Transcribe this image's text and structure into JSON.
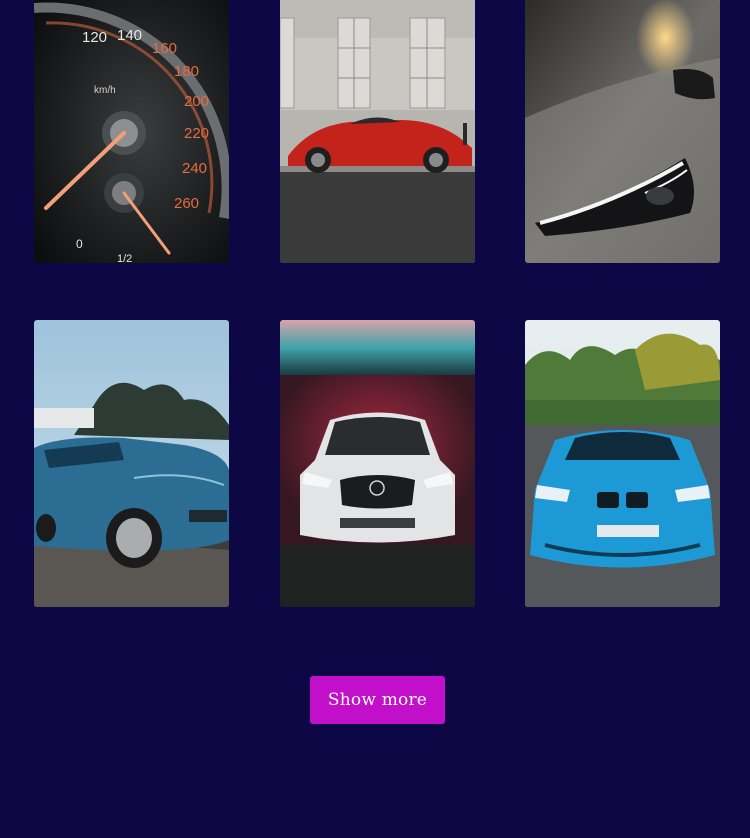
{
  "gallery": {
    "items": [
      {
        "subject": "speedometer",
        "speed_ticks": [
          "120",
          "140",
          "160",
          "180",
          "200",
          "220",
          "240",
          "260"
        ],
        "unit": "km/h",
        "fuel_ticks": [
          "0",
          "1/2"
        ]
      },
      {
        "subject": "red sports car"
      },
      {
        "subject": "grey car headlight"
      },
      {
        "subject": "blue hatchback"
      },
      {
        "subject": "white suv in garage"
      },
      {
        "subject": "blue coupe"
      }
    ]
  },
  "actions": {
    "show_more_label": "Show more"
  },
  "colors": {
    "background": "#0e0745",
    "button": "#c20fc9",
    "button_text": "#ffffff"
  }
}
